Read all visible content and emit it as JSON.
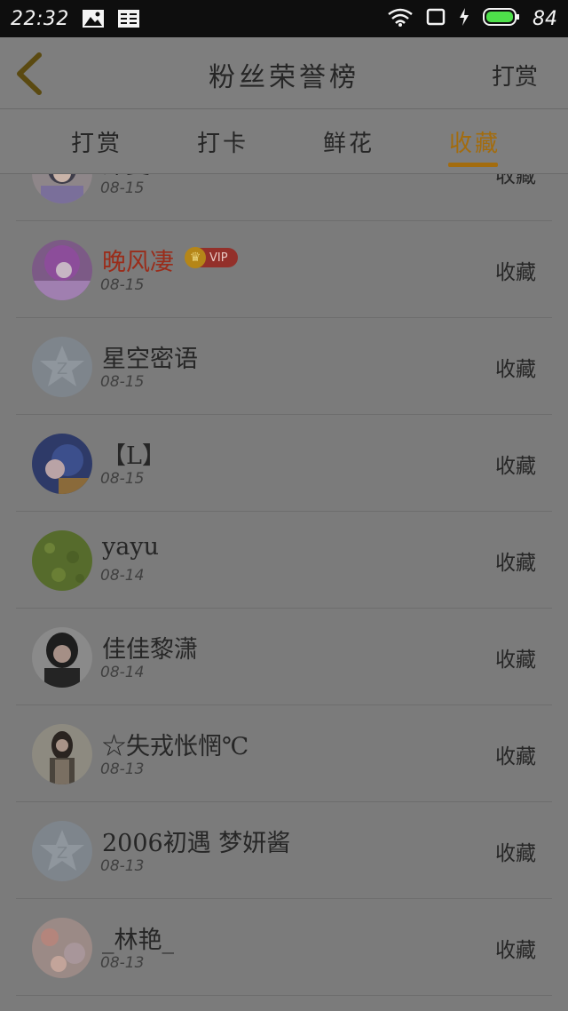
{
  "status": {
    "time": "22:32",
    "battery": "84",
    "icons": [
      "image-icon",
      "news-icon",
      "wifi-icon",
      "screen-icon",
      "charging-icon",
      "battery-icon"
    ]
  },
  "header": {
    "title": "粉丝荣誉榜",
    "action": "打赏"
  },
  "tabs": [
    {
      "label": "打赏"
    },
    {
      "label": "打卡"
    },
    {
      "label": "鲜花"
    },
    {
      "label": "收藏"
    }
  ],
  "colors": {
    "accent": "#a36c0e",
    "vip_name": "#9a2c1a"
  },
  "list": [
    {
      "name": "深夏",
      "date": "08-15",
      "action": "收藏",
      "avatar": "cartoon-girl-avatar"
    },
    {
      "name": "晚风凄",
      "date": "08-15",
      "action": "收藏",
      "avatar": "anime-purple-avatar",
      "vip": "VIP"
    },
    {
      "name": "星空密语",
      "date": "08-15",
      "action": "收藏",
      "avatar": "default-qq-avatar"
    },
    {
      "name": "【L】",
      "date": "08-15",
      "action": "收藏",
      "avatar": "anime-blue-avatar"
    },
    {
      "name": "yayu",
      "date": "08-14",
      "action": "收藏",
      "avatar": "green-field-avatar"
    },
    {
      "name": "佳佳黎潇",
      "date": "08-14",
      "action": "收藏",
      "avatar": "girl-photo-avatar"
    },
    {
      "name": "☆失戎怅惘℃",
      "date": "08-13",
      "action": "收藏",
      "avatar": "woman-photo-avatar"
    },
    {
      "name": "2006初遇 梦妍酱",
      "date": "08-13",
      "action": "收藏",
      "avatar": "default-qq-avatar"
    },
    {
      "name": "_林艳_",
      "date": "08-13",
      "action": "收藏",
      "avatar": "floral-avatar"
    }
  ]
}
